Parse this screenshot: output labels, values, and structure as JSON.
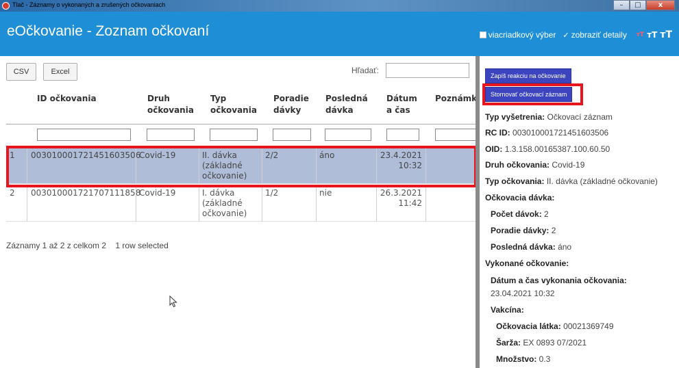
{
  "window": {
    "title": "Tlač - Záznamy o vykonaných a zrušených očkovaniach",
    "minimize": "–",
    "maximize": "□",
    "close": "x"
  },
  "header": {
    "title": "eOčkovanie - Zoznam očkovaní",
    "multi_select_label": "viacriadkový výber",
    "show_details_label": "zobraziť detaily",
    "show_details_checked": true,
    "multi_select_checked": false,
    "font_size_small": "тT",
    "font_size_mid": "тT",
    "font_size_large": "тT"
  },
  "toolbar": {
    "csv": "CSV",
    "excel": "Excel",
    "search_label": "Hľadať:",
    "search_value": ""
  },
  "table": {
    "headers": [
      "ID očkovania",
      "Druh očkovania",
      "Typ očkovania",
      "Poradie dávky",
      "Posledná dávka",
      "Dátum a čas",
      "Poznámk"
    ],
    "rows": [
      {
        "num": "1",
        "id": "003010001721451603506",
        "druh": "Covid-19",
        "typ": "II. dávka (základné očkovanie)",
        "poradie": "2/2",
        "posledna": "áno",
        "datum": "23.4.2021",
        "cas": "10:32",
        "poznamka": "",
        "selected": true
      },
      {
        "num": "2",
        "id": "003010001721707111858",
        "druh": "Covid-19",
        "typ": "I. dávka (základné očkovanie)",
        "poradie": "1/2",
        "posledna": "nie",
        "datum": "26.3.2021",
        "cas": "11:42",
        "poznamka": "",
        "selected": false
      }
    ],
    "footer": "Záznamy 1 až 2 z celkom 2",
    "selection_info": "1 row selected"
  },
  "detail": {
    "btn_reaction": "Zapíš reakciu na očkovanie",
    "btn_cancel": "Stornovať očkovací záznam",
    "typ_vysetrenia_label": "Typ vyšetrenia:",
    "typ_vysetrenia": "Očkovací záznam",
    "rc_id_label": "RC ID:",
    "rc_id": "003010001721451603506",
    "oid_label": "OID:",
    "oid": "1.3.158.00165387.100.60.50",
    "druh_label": "Druh očkovania:",
    "druh": "Covid-19",
    "typ_label": "Typ očkovania:",
    "typ": "II. dávka (základné očkovanie)",
    "davka_section": "Očkovacia dávka:",
    "pocet_label": "Počet dávok:",
    "pocet": "2",
    "poradie_label": "Poradie dávky:",
    "poradie": "2",
    "posledna_label": "Posledná dávka:",
    "posledna": "áno",
    "vykonane_section": "Vykonané očkovanie:",
    "datum_cas_label": "Dátum a čas vykonania očkovania:",
    "datum_cas": "23.04.2021 10:32",
    "vakcina_section": "Vakcína:",
    "latka_label": "Očkovacia látka:",
    "latka": "00021369749",
    "sarza_label": "Šarža:",
    "sarza": "EX 0893 07/2021",
    "mnozstvo_label": "Množstvo:",
    "mnozstvo": "0.3"
  },
  "colors": {
    "header_bg": "#1e8fd6",
    "selected_row": "#b0bdd8",
    "highlight": "#e8141e",
    "detail_button": "#3c44c0"
  }
}
